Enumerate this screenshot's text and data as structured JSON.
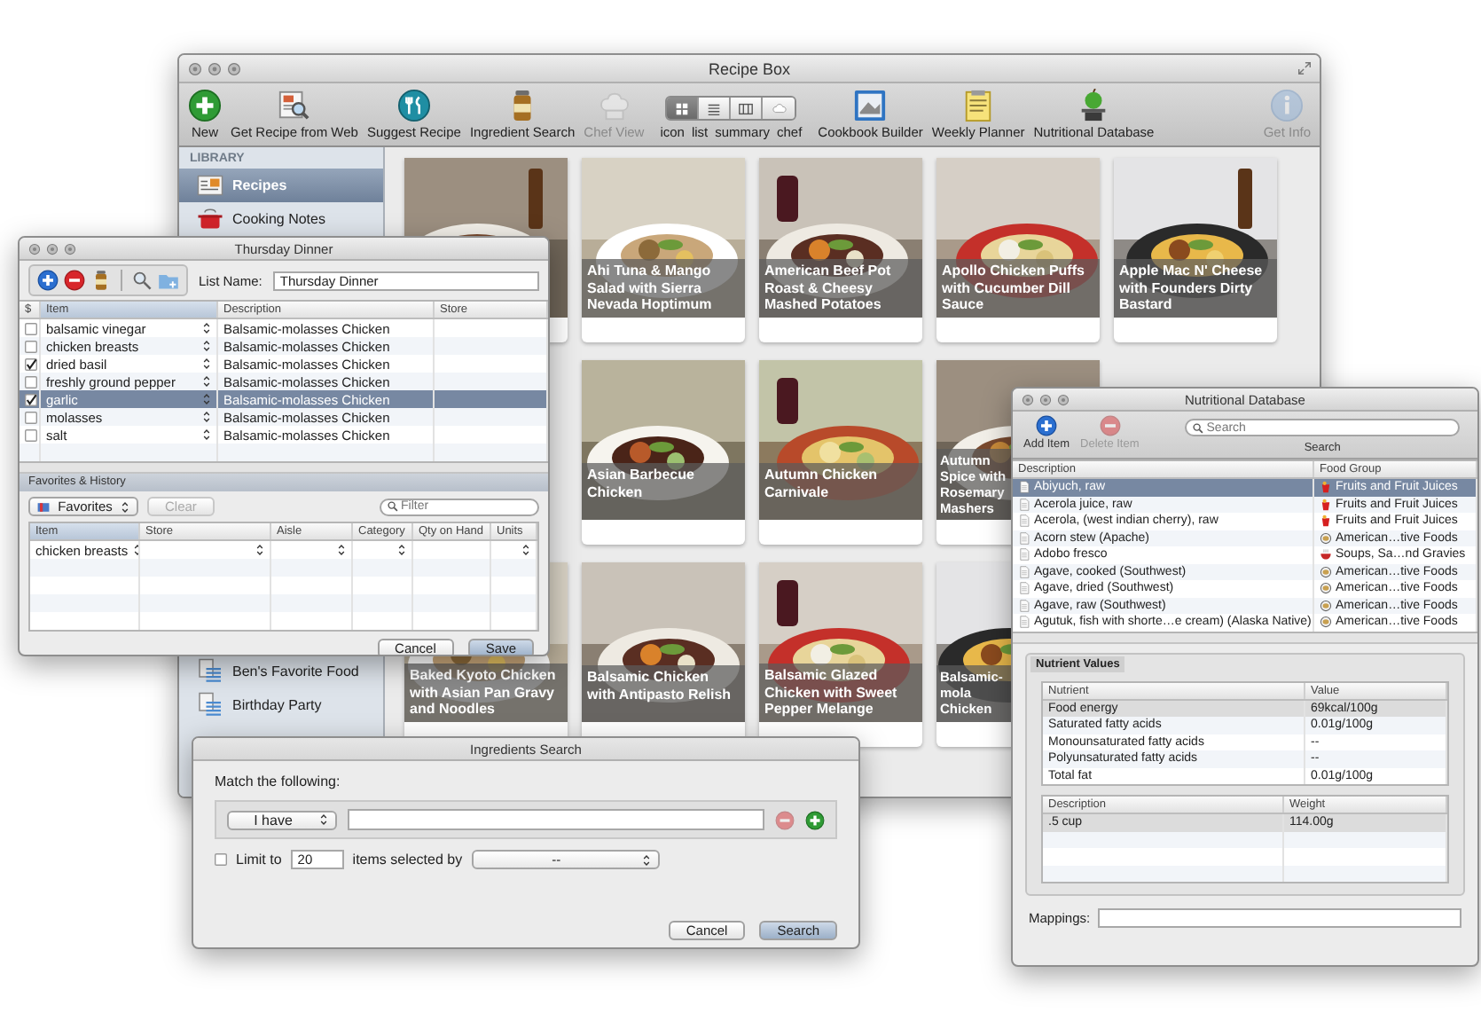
{
  "main_window": {
    "title": "Recipe Box"
  },
  "toolbar": {
    "buttons": [
      {
        "label": "New",
        "disabled": false
      },
      {
        "label": "Get Recipe from Web",
        "disabled": false
      },
      {
        "label": "Suggest Recipe",
        "disabled": false
      },
      {
        "label": "Ingredient Search",
        "disabled": false
      },
      {
        "label": "Chef View",
        "disabled": true
      }
    ],
    "view_modes": [
      {
        "label": "icon",
        "selected": true
      },
      {
        "label": "list",
        "selected": false
      },
      {
        "label": "summary",
        "selected": false
      },
      {
        "label": "chef",
        "selected": false
      }
    ],
    "tools": [
      {
        "label": "Cookbook Builder",
        "disabled": false
      },
      {
        "label": "Weekly Planner",
        "disabled": false
      },
      {
        "label": "Nutritional Database",
        "disabled": false
      }
    ],
    "info_button": {
      "label": "Get Info",
      "disabled": true
    }
  },
  "sidebar": {
    "heading": "LIBRARY",
    "items": [
      {
        "label": "Recipes",
        "selected": true
      },
      {
        "label": "Cooking Notes",
        "selected": false
      }
    ],
    "lists": [
      {
        "label": "Ben's Favorite Food",
        "selected": false
      },
      {
        "label": "Birthday Party",
        "selected": false
      }
    ]
  },
  "recipes": [
    {
      "kind": "picture"
    },
    {
      "kind": "card",
      "caption": "Ahi Tuna & Mango Salad with Sierra Nevada Hoptimum"
    },
    {
      "kind": "card",
      "caption": "American Beef Pot Roast & Cheesy Mashed Potatoes"
    },
    {
      "kind": "card",
      "caption": "Apollo Chicken Puffs with Cucumber Dill Sauce"
    },
    {
      "kind": "card",
      "caption": "Apple Mac N' Cheese with Founders Dirty Bastard"
    },
    {
      "kind": "card",
      "caption": "Asian Barbecue Chicken"
    },
    {
      "kind": "card",
      "caption": "Autumn Chicken Carnivale"
    },
    {
      "kind": "cut",
      "caption": "Autumn Spice with Rosemary Mashers"
    },
    {
      "kind": "card",
      "caption": "Baked Kyoto Chicken with Asian Pan Gravy and Noodles"
    },
    {
      "kind": "card",
      "caption": "Balsamic Chicken with Antipasto Relish"
    },
    {
      "kind": "card",
      "caption": "Balsamic Glazed Chicken with Sweet Pepper Melange"
    },
    {
      "kind": "cut",
      "caption": "Balsamic-mola Chicken"
    }
  ],
  "shopping_list": {
    "title": "Thursday Dinner",
    "list_name_label": "List Name:",
    "list_name": "Thursday Dinner",
    "columns": [
      "$",
      "Item",
      "Description",
      "Store"
    ],
    "rows": [
      {
        "checked": false,
        "item": "balsamic vinegar",
        "description": "Balsamic-molasses Chicken",
        "selected": false
      },
      {
        "checked": false,
        "item": "chicken breasts",
        "description": "Balsamic-molasses Chicken",
        "selected": false
      },
      {
        "checked": true,
        "item": "dried basil",
        "description": "Balsamic-molasses Chicken",
        "selected": false
      },
      {
        "checked": false,
        "item": "freshly ground pepper",
        "description": "Balsamic-molasses Chicken",
        "selected": false
      },
      {
        "checked": true,
        "item": "garlic",
        "description": "Balsamic-molasses Chicken",
        "selected": true
      },
      {
        "checked": false,
        "item": "molasses",
        "description": "Balsamic-molasses Chicken",
        "selected": false
      },
      {
        "checked": false,
        "item": "salt",
        "description": "Balsamic-molasses Chicken",
        "selected": false
      }
    ],
    "favorites": {
      "heading": "Favorites & History",
      "source": "Favorites",
      "clear": "Clear",
      "clear_disabled": true,
      "filter_placeholder": "Filter",
      "columns": [
        "Item",
        "Store",
        "Aisle",
        "Category",
        "Qty on Hand",
        "Units"
      ],
      "rows": [
        {
          "item": "chicken breasts"
        }
      ]
    },
    "buttons": [
      "Cancel",
      "Save"
    ]
  },
  "nutrition": {
    "title": "Nutritional Database",
    "add": "Add Item",
    "delete": "Delete Item",
    "delete_disabled": true,
    "search_placeholder": "Search",
    "search_label": "Search",
    "columns": [
      "Description",
      "Food Group"
    ],
    "foods": [
      {
        "description": "Abiyuch, raw",
        "group": "Fruits and Fruit Juices",
        "kind": "fruit",
        "selected": true
      },
      {
        "description": "Acerola juice, raw",
        "group": "Fruits and Fruit Juices",
        "kind": "fruit",
        "selected": false
      },
      {
        "description": "Acerola, (west indian cherry), raw",
        "group": "Fruits and Fruit Juices",
        "kind": "fruit",
        "selected": false
      },
      {
        "description": "Acorn stew (Apache)",
        "group": "American…tive Foods",
        "kind": "native",
        "selected": false
      },
      {
        "description": "Adobo fresco",
        "group": "Soups, Sa…nd Gravies",
        "kind": "soup",
        "selected": false
      },
      {
        "description": "Agave, cooked (Southwest)",
        "group": "American…tive Foods",
        "kind": "native",
        "selected": false
      },
      {
        "description": "Agave, dried (Southwest)",
        "group": "American…tive Foods",
        "kind": "native",
        "selected": false
      },
      {
        "description": "Agave, raw (Southwest)",
        "group": "American…tive Foods",
        "kind": "native",
        "selected": false
      },
      {
        "description": "Agutuk, fish with shorte…e cream) (Alaska Native)",
        "group": "American…tive Foods",
        "kind": "native",
        "selected": false
      }
    ],
    "group_title": "Nutrient Values",
    "nutrient_columns": [
      "Nutrient",
      "Value"
    ],
    "nutrients": [
      {
        "name": "Food energy",
        "value": "69kcal/100g",
        "selected": true
      },
      {
        "name": "Saturated fatty acids",
        "value": "0.01g/100g",
        "selected": false
      },
      {
        "name": "Monounsaturated fatty acids",
        "value": "--",
        "selected": false
      },
      {
        "name": "Polyunsaturated fatty acids",
        "value": "--",
        "selected": false
      },
      {
        "name": "Total fat",
        "value": "0.01g/100g",
        "selected": false
      }
    ],
    "weight_columns": [
      "Description",
      "Weight"
    ],
    "weights": [
      {
        "description": ".5 cup",
        "weight": "114.00g",
        "selected": true
      }
    ],
    "mappings_label": "Mappings:"
  },
  "ingredients_search": {
    "title": "Ingredients Search",
    "prompt": "Match the following:",
    "condition": "I have",
    "remove_disabled": true,
    "limit": {
      "checked": false,
      "label": "Limit to",
      "count": "20",
      "suffix": "items selected by",
      "order": "--"
    },
    "buttons": [
      "Cancel",
      "Search"
    ]
  }
}
